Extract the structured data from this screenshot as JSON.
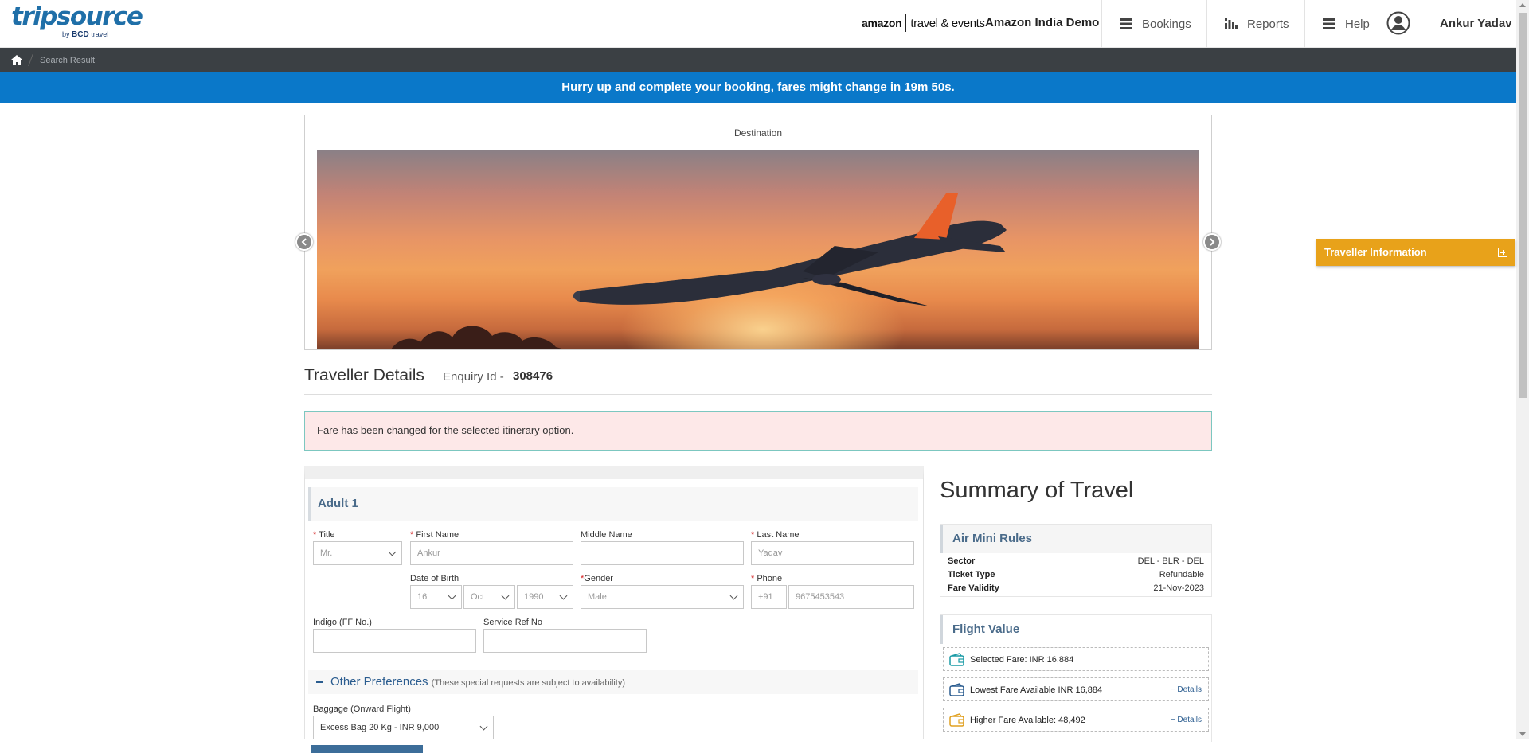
{
  "header": {
    "logo_main": "tripsource",
    "logo_by": "by",
    "logo_bcd": "BCD",
    "logo_travel": "travel",
    "brand_amazon": "amazon",
    "brand_te": "travel & events",
    "company": "Amazon India Demo",
    "nav": [
      {
        "label": "Bookings",
        "icon": "hamburger-icon"
      },
      {
        "label": "Reports",
        "icon": "bar-chart-icon"
      },
      {
        "label": "Help",
        "icon": "hamburger-icon"
      }
    ],
    "user_name": "Ankur Yadav"
  },
  "breadcrumb": {
    "current": "Search Result"
  },
  "timer": {
    "prefix": "Hurry up and complete your booking, fares might change in ",
    "time": "19m 50s."
  },
  "destination": {
    "title": "Destination"
  },
  "traveller": {
    "title": "Traveller Details",
    "enquiry_label": "Enquiry Id -",
    "enquiry_id": "308476"
  },
  "alert": {
    "message": "Fare has been changed for the selected itinerary option."
  },
  "form": {
    "adult_label": "Adult 1",
    "title_label": "Title",
    "title_value": "Mr.",
    "first_label": "First Name",
    "first_value": "Ankur",
    "middle_label": "Middle Name",
    "middle_value": "",
    "last_label": "Last Name",
    "last_value": "Yadav",
    "dob_label": "Date of Birth",
    "dob_day": "16",
    "dob_month": "Oct",
    "dob_year": "1990",
    "gender_label": "Gender",
    "gender_value": "Male",
    "phone_label": "Phone",
    "phone_code": "+91",
    "phone_value": "9675453543",
    "ff_label": "Indigo (FF No.)",
    "ff_value": "",
    "sref_label": "Service Ref No",
    "sref_value": "",
    "prefs_title": "Other Preferences",
    "prefs_note": "(These special requests are subject to availability)",
    "baggage_label": "Baggage (Onward Flight)",
    "baggage_value": "Excess Bag 20 Kg - INR 9,000"
  },
  "summary": {
    "title": "Summary of Travel",
    "rules_title": "Air Mini Rules",
    "rules": [
      {
        "k": "Sector",
        "v": "DEL - BLR - DEL"
      },
      {
        "k": "Ticket Type",
        "v": "Refundable"
      },
      {
        "k": "Fare Validity",
        "v": "21-Nov-2023"
      }
    ],
    "flight_value_title": "Flight Value",
    "fares": [
      {
        "label": "Selected Fare:",
        "value": "INR 16,884",
        "details": "",
        "color": "#1a9ba6"
      },
      {
        "label": "Lowest Fare Available",
        "value": "INR 16,884",
        "details": "Details",
        "color": "#2a5c8f"
      },
      {
        "label": "Higher Fare Available:",
        "value": "48,492",
        "details": "Details",
        "color": "#e0a020"
      }
    ]
  },
  "side_panel": {
    "label": "Traveller Information"
  },
  "colors": {
    "timer_bar": "#0a78c9",
    "breadcrumb_bar": "#3b4044",
    "traveller_panel": "#e8a21a",
    "alert_bg": "#fde8e8"
  }
}
